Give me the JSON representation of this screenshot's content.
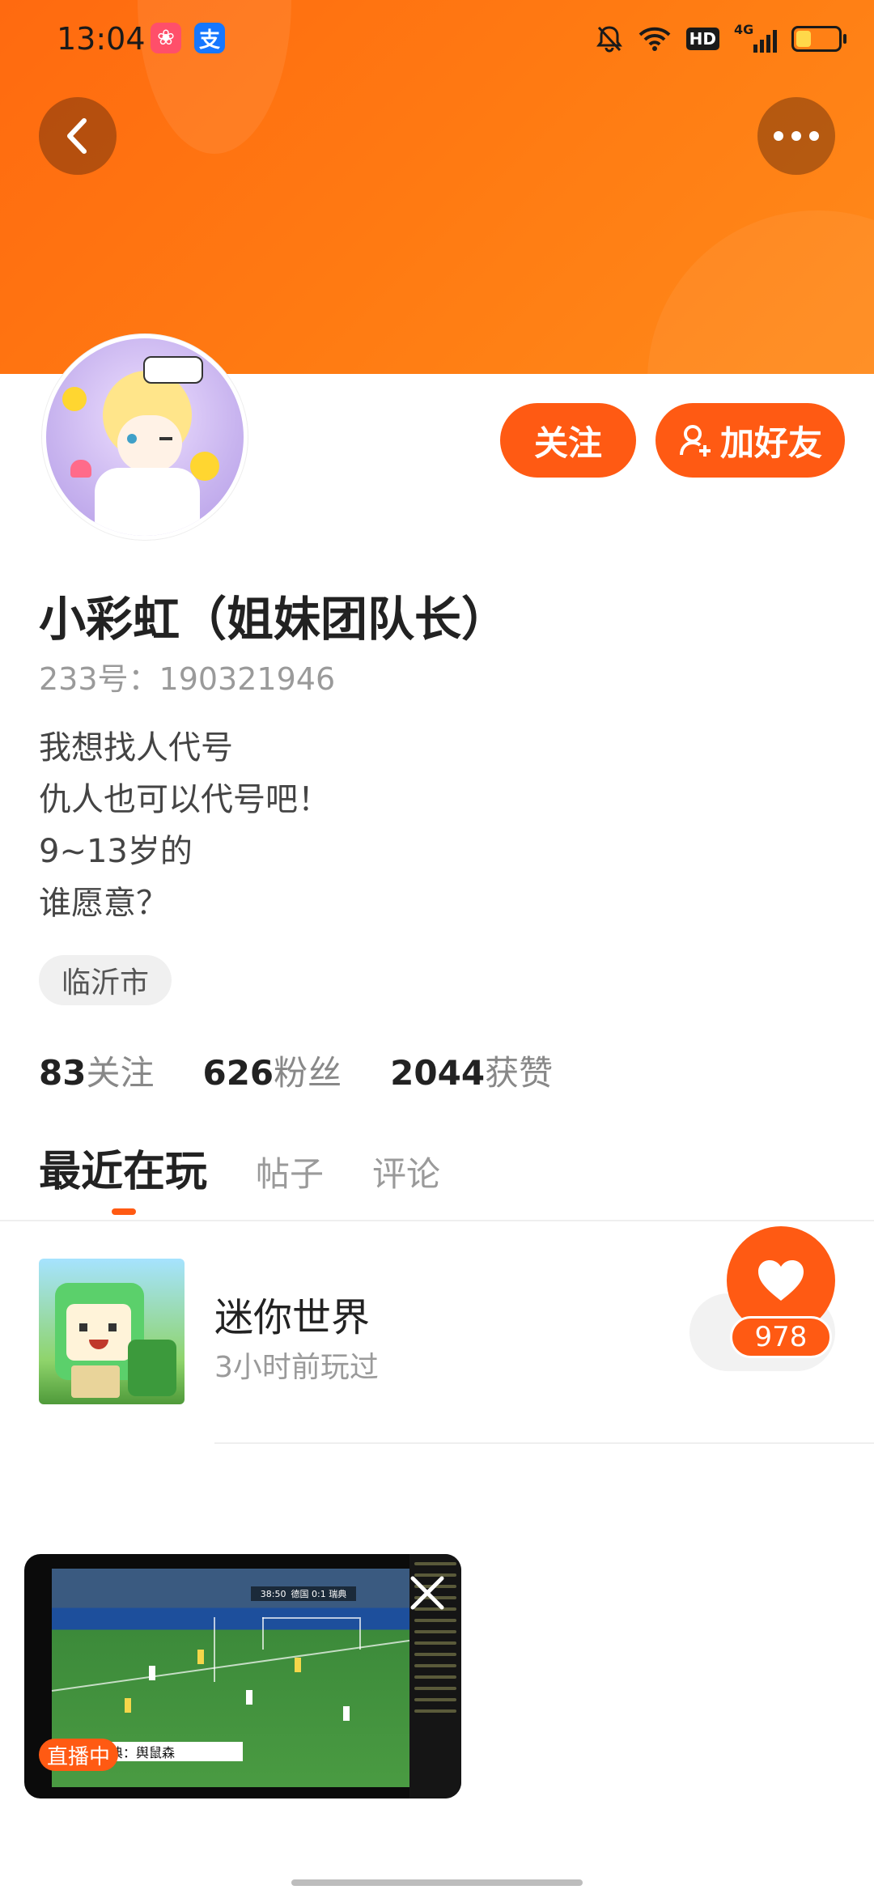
{
  "status_bar": {
    "time": "13:04",
    "network": "4G",
    "hd": "HD"
  },
  "profile": {
    "name": "小彩虹（姐妹团队长）",
    "uid": "233号：190321946",
    "bio": [
      "我想找人代号",
      "仇人也可以代号吧！",
      "9~13岁的",
      "谁愿意？"
    ],
    "location": "临沂市"
  },
  "actions": {
    "follow": "关注",
    "add_friend": "加好友"
  },
  "stats": [
    {
      "num": "83",
      "label": "关注"
    },
    {
      "num": "626",
      "label": "粉丝"
    },
    {
      "num": "2044",
      "label": "获赞"
    }
  ],
  "tabs": [
    "最近在玩",
    "帖子",
    "评论"
  ],
  "recent_game": {
    "name": "迷你世界",
    "time": "3小时前玩过",
    "likes": "978"
  },
  "video": {
    "live_label": "直播中",
    "score": "德国 0:1 瑞典",
    "clock": "38:50",
    "caption": "典：舆鼠森"
  },
  "colors": {
    "accent": "#ff5a13",
    "header": "#ff7a12"
  },
  "icons": [
    "back-arrow-icon",
    "more-dots-icon",
    "add-friend-icon",
    "heart-icon",
    "close-icon"
  ]
}
